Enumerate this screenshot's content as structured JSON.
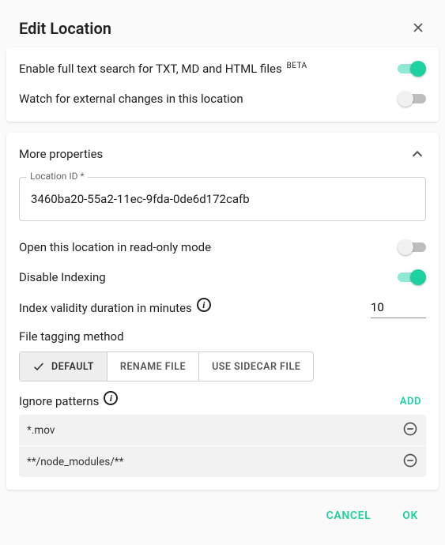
{
  "dialog": {
    "title": "Edit Location",
    "full_text_label": "Enable full text search for TXT, MD and HTML files",
    "full_text_beta": "BETA",
    "full_text_on": true,
    "watch_label": "Watch for external changes in this location",
    "watch_on": false
  },
  "more": {
    "header": "More properties",
    "expanded": true,
    "location_id_label": "Location ID *",
    "location_id_value": "3460ba20-55a2-11ec-9fda-0de6d172cafb",
    "readonly_label": "Open this location in read-only mode",
    "readonly_on": false,
    "disable_index_label": "Disable Indexing",
    "disable_index_on": true,
    "validity_label": "Index validity duration in minutes",
    "validity_value": "10",
    "tagging_label": "File tagging method",
    "tagging_options": {
      "default": "DEFAULT",
      "rename": "RENAME FILE",
      "sidecar": "USE SIDECAR FILE"
    },
    "ignore_label": "Ignore patterns",
    "add_label": "ADD",
    "patterns": [
      "*.mov",
      "**/node_modules/**"
    ]
  },
  "actions": {
    "cancel": "CANCEL",
    "ok": "OK"
  }
}
